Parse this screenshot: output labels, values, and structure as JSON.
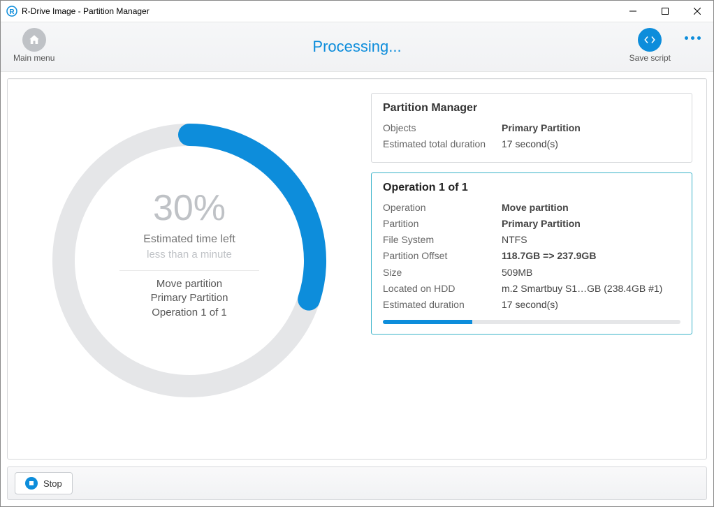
{
  "window": {
    "title": "R-Drive Image - Partition Manager"
  },
  "toolbar": {
    "main_menu": "Main menu",
    "processing": "Processing...",
    "save_script": "Save script"
  },
  "progress": {
    "percent": "30%",
    "arc_angle_deg": 108,
    "est_label": "Estimated time left",
    "est_value": "less than a minute",
    "line1": "Move partition",
    "line2": "Primary Partition",
    "line3": "Operation 1 of 1"
  },
  "summary_panel": {
    "title": "Partition Manager",
    "rows": {
      "objects_k": "Objects",
      "objects_v": "Primary Partition",
      "dur_k": "Estimated total duration",
      "dur_v": "17 second(s)"
    }
  },
  "op_panel": {
    "title": "Operation 1 of 1",
    "rows": {
      "op_k": "Operation",
      "op_v": "Move partition",
      "part_k": "Partition",
      "part_v": "Primary Partition",
      "fs_k": "File System",
      "fs_v": "NTFS",
      "off_k": "Partition Offset",
      "off_v": "118.7GB => 237.9GB",
      "size_k": "Size",
      "size_v": "509MB",
      "hdd_k": "Located on HDD",
      "hdd_v": "m.2 Smartbuy S1…GB (238.4GB #1)",
      "dur_k": "Estimated duration",
      "dur_v": "17 second(s)"
    },
    "progress_pct": 30
  },
  "footer": {
    "stop": "Stop"
  }
}
